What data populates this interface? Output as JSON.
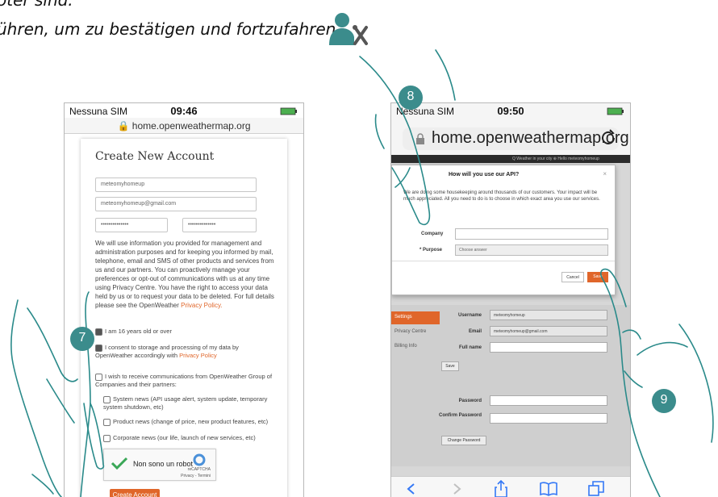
{
  "doc": {
    "line1": "oter sind.",
    "line2": "ühren, um zu bestätigen und fortzufahren."
  },
  "colors": {
    "accent": "#e0662a",
    "callout": "#3b8c8c",
    "hand_outline": "#2a8a8a"
  },
  "left_phone": {
    "carrier": "Nessuna SIM",
    "time": "09:46",
    "url": "home.openweathermap.org",
    "form": {
      "title": "Create New Account",
      "username": "meteomyhomeup",
      "email": "meteomyhomeup@gmail.com",
      "password": "••••••••••••••",
      "password_confirm": "••••••••••••••",
      "consent_text": "We will use information you provided for management and administration purposes and for keeping you informed by mail, telephone, email and SMS of other products and services from us and our partners. You can proactively manage your preferences or opt-out of communications with us at any time using Privacy Centre. You have the right to access your data held by us or to request your data to be deleted. For full details please see the OpenWeather",
      "privacy_link": "Privacy Policy.",
      "age_check": "I am 16 years old or over",
      "storage_check_prefix": "I consent to storage and processing of my data by OpenWeather accordingly with",
      "storage_link": "Privacy Policy",
      "comms_intro": "I wish to receive communications from OpenWeather Group of Companies and their partners:",
      "system_news": "System news (API usage alert, system update, temporary system shutdown, etc)",
      "product_news": "Product news (change of price, new product features, etc)",
      "corporate_news": "Corporate news (our life, launch of new services, etc)",
      "captcha_label": "Non sono un robot",
      "captcha_brand": "reCAPTCHA",
      "captcha_terms": "Privacy - Termini",
      "create_button": "Create Account"
    }
  },
  "right_phone": {
    "carrier": "Nessuna SIM",
    "time": "09:50",
    "url": "home.openweathermap.org",
    "nav_bar": "Q Weather in your city   ⊕ Hello meteomyhomeup",
    "modal": {
      "title": "How will you use our API?",
      "body": "We are doing some housekeeping around thousands of our customers. Your impact will be much appreciated. All you need to do is to choose in which exact area you use our services.",
      "company_label": "Company",
      "purpose_label": "* Purpose",
      "purpose_placeholder": "Choose answer",
      "cancel": "Cancel",
      "save": "Save"
    },
    "sidebar": [
      "Settings",
      "Privacy Centre",
      "Billing Info"
    ],
    "profile": {
      "username_label": "Username",
      "username_value": "meteomyhomeup",
      "email_label": "Email",
      "email_value": "meteomyhomeup@gmail.com",
      "fullname_label": "Full name",
      "save": "Save",
      "password_label": "Password",
      "confirm_label": "Confirm Password",
      "change_password": "Change Password"
    }
  },
  "callouts": {
    "step7": "7",
    "step8": "8",
    "step9": "9"
  }
}
